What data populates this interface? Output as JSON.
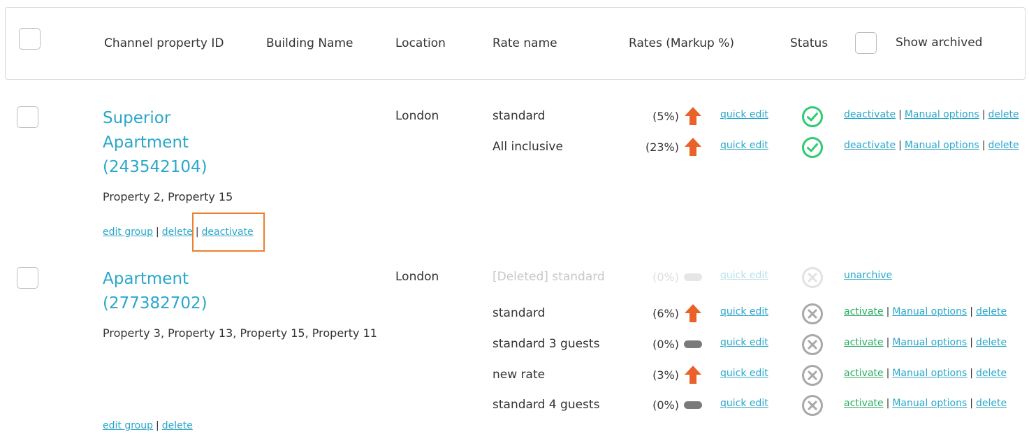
{
  "header": {
    "col_id": "Channel property ID",
    "col_building": "Building Name",
    "col_location": "Location",
    "col_rate": "Rate name",
    "col_rates": "Rates (Markup %)",
    "col_status": "Status",
    "show_archived": "Show archived"
  },
  "groups": [
    {
      "title_line1": "Superior",
      "title_line2": "Apartment",
      "title_line3": "(243542104)",
      "properties": "Property 2, Property 15",
      "location": "London",
      "actions": {
        "edit": "edit group",
        "delete": "delete",
        "deactivate": "deactivate",
        "sep": "|"
      },
      "rates": [
        {
          "name": "standard",
          "markup": "(5%)",
          "indicator": "up-arrow",
          "quick_edit": "quick edit",
          "status": "active",
          "a1": "deactivate",
          "a2": "Manual options",
          "a3": "delete"
        },
        {
          "name": "All inclusive",
          "markup": "(23%)",
          "indicator": "up-arrow",
          "quick_edit": "quick edit",
          "status": "active",
          "a1": "deactivate",
          "a2": "Manual options",
          "a3": "delete"
        }
      ]
    },
    {
      "title_line1": "Apartment",
      "title_line2": "(277382702)",
      "properties": "Property 3, Property 13, Property 15, Property 11",
      "location": "London",
      "actions": {
        "edit": "edit group",
        "delete": "delete",
        "sep": "|"
      },
      "rates": [
        {
          "name": "[Deleted] standard",
          "markup": "(0%)",
          "indicator": "neutral",
          "quick_edit": "quick edit",
          "status": "deleted",
          "a1": "unarchive"
        },
        {
          "name": "standard",
          "markup": "(6%)",
          "indicator": "up-arrow",
          "quick_edit": "quick edit",
          "status": "inactive",
          "a1": "activate",
          "a2": "Manual options",
          "a3": "delete"
        },
        {
          "name": "standard 3 guests",
          "markup": "(0%)",
          "indicator": "neutral",
          "quick_edit": "quick edit",
          "status": "inactive",
          "a1": "activate",
          "a2": "Manual options",
          "a3": "delete"
        },
        {
          "name": "new rate",
          "markup": "(3%)",
          "indicator": "up-arrow",
          "quick_edit": "quick edit",
          "status": "inactive",
          "a1": "activate",
          "a2": "Manual options",
          "a3": "delete"
        },
        {
          "name": "standard 4 guests",
          "markup": "(0%)",
          "indicator": "neutral",
          "quick_edit": "quick edit",
          "status": "inactive",
          "a1": "activate",
          "a2": "Manual options",
          "a3": "delete"
        }
      ]
    }
  ],
  "colors": {
    "accent": "#2aa7c9",
    "active": "#2ecc71",
    "inactive": "#9e9e9e",
    "arrow": "#e8622a",
    "highlight": "#ee7d2d"
  }
}
